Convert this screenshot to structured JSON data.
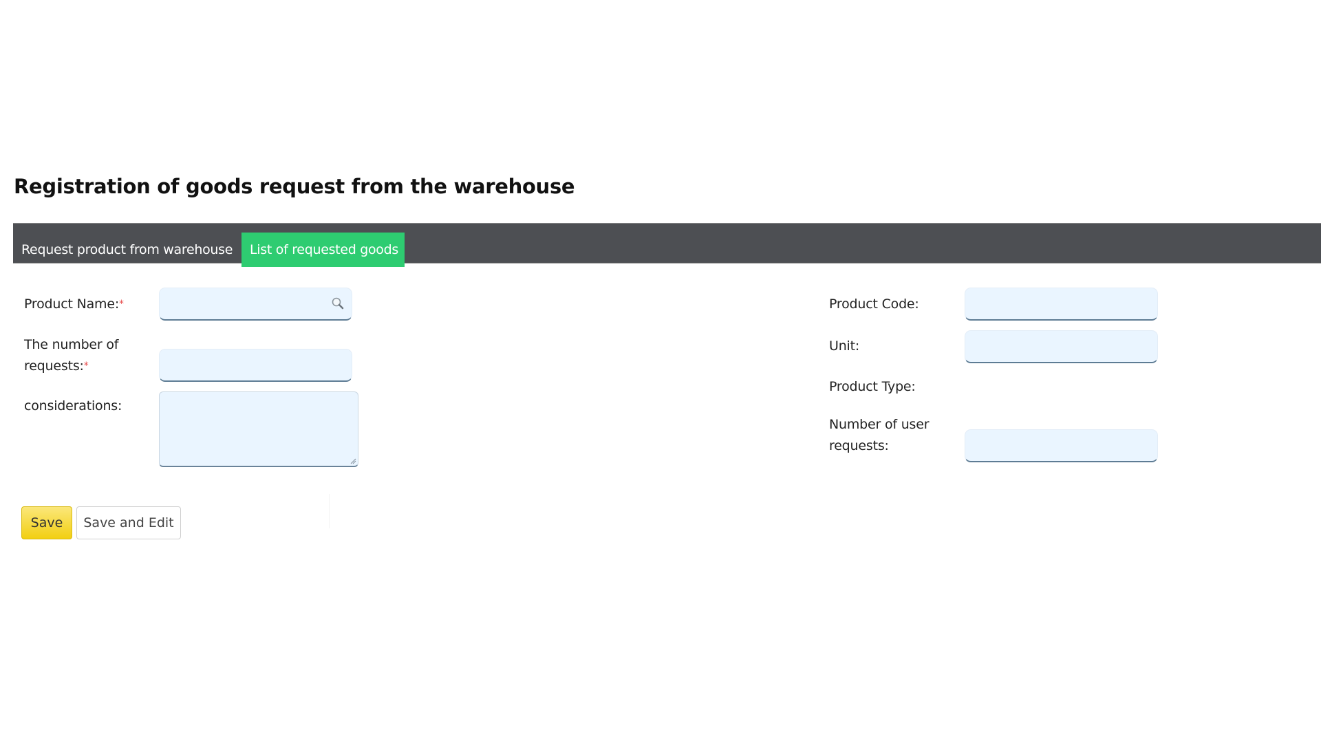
{
  "page": {
    "title": "Registration of goods request from the warehouse"
  },
  "tabs": [
    {
      "label": "Request product from warehouse",
      "active": false
    },
    {
      "label": "List of requested goods",
      "active": true
    }
  ],
  "colors": {
    "tabbar_bg": "#4d4f53",
    "active_tab_bg": "#2ecc71",
    "input_bg": "#eaf5ff",
    "save_button": "#f2cf12",
    "required_marker": "#e64a4a"
  },
  "form": {
    "left": {
      "product_name": {
        "label": "Product Name:",
        "required_marker": "*",
        "value": "",
        "icon": "search-icon"
      },
      "number_of_requests": {
        "label_line1": "The number of",
        "label_line2": "requests:",
        "required_marker": "*",
        "value": ""
      },
      "considerations": {
        "label": "considerations:",
        "value": ""
      }
    },
    "right": {
      "product_code": {
        "label": "Product Code:",
        "value": ""
      },
      "unit": {
        "label": "Unit:",
        "value": ""
      },
      "product_type": {
        "label": "Product Type:"
      },
      "number_of_user_requests": {
        "label_line1": "Number of user",
        "label_line2": "requests:",
        "value": ""
      }
    }
  },
  "buttons": {
    "save": "Save",
    "save_and_edit": "Save and Edit"
  }
}
